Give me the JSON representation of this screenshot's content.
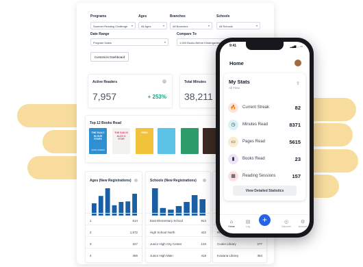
{
  "filters": {
    "programs": {
      "label": "Programs",
      "value": "Summer Reading Challenge"
    },
    "ages": {
      "label": "Ages",
      "value": "All Ages"
    },
    "branches": {
      "label": "Branches",
      "value": "All Branches"
    },
    "schools": {
      "label": "Schools",
      "value": "All Schools"
    },
    "date_range": {
      "label": "Date Range",
      "value": "Program Dates"
    },
    "compare_to": {
      "label": "Compare To",
      "value": "1,000 Books Before Kindergarten"
    },
    "customize_label": "Customize Dashboard"
  },
  "stats": {
    "active_readers": {
      "title": "Active Readers",
      "value": "7,957",
      "change": "+ 253%"
    },
    "total_minutes": {
      "title": "Total Minutes",
      "value": "38,211"
    }
  },
  "books": {
    "title": "Top 12 Books Read",
    "items": [
      {
        "name": "the-fault-in-our-stars",
        "cover_text": "THE FAULT IN OUR STARS",
        "author": "JOHN GREEN",
        "bg": "#2e8fd1",
        "fg": "#ffffff"
      },
      {
        "name": "the-sun-is-also-a-star",
        "cover_text": "THE SUN IS ALSO A STAR",
        "author": "",
        "bg": "#f2f2ee",
        "fg": "#e7357a"
      },
      {
        "name": "fred",
        "cover_text": "FRED",
        "author": "",
        "bg": "#f1c33b",
        "fg": "#ffffff"
      },
      {
        "name": "wonder",
        "cover_text": "",
        "author": "",
        "bg": "#5cc2e6",
        "fg": "#ffffff"
      },
      {
        "name": "green-book",
        "cover_text": "",
        "author": "",
        "bg": "#2d9c6a",
        "fg": "#ffffff"
      },
      {
        "name": "dark-book",
        "cover_text": "",
        "author": "",
        "bg": "#3c2a22",
        "fg": "#ffffff"
      }
    ]
  },
  "ages_chart": {
    "title": "Ages (New Registrations)",
    "chart_data": {
      "type": "bar",
      "values": [
        0.45,
        0.72,
        1.0,
        0.38,
        0.5,
        0.52,
        0.8
      ],
      "ylim": [
        0,
        1
      ]
    },
    "rows": [
      {
        "label": "1",
        "value": "614"
      },
      {
        "label": "2",
        "value": "1,572"
      },
      {
        "label": "3",
        "value": "327"
      },
      {
        "label": "4",
        "value": "456"
      }
    ]
  },
  "schools_chart": {
    "title": "Schools (New Registrations)",
    "chart_data": {
      "type": "bar",
      "values": [
        1.0,
        0.28,
        0.22,
        0.35,
        0.5,
        0.75,
        0.6
      ],
      "ylim": [
        0,
        1
      ]
    },
    "rows": [
      {
        "label": "East Elementary School",
        "value": "814"
      },
      {
        "label": "High School North",
        "value": "422"
      },
      {
        "label": "Junior High City Center",
        "value": "133"
      },
      {
        "label": "Junior High Main",
        "value": "418"
      }
    ]
  },
  "third_chart": {
    "rows": [
      {
        "label": "Cesi",
        "value": ""
      },
      {
        "label": "Rive",
        "value": ""
      },
      {
        "label": "Cooks Library",
        "value": "277"
      },
      {
        "label": "Kowana Library",
        "value": "364"
      }
    ]
  },
  "phone": {
    "time": "9:41",
    "header": "Home",
    "card_title": "My Stats",
    "card_subtitle": "All Time",
    "stats": [
      {
        "label": "Current Streak",
        "value": "82",
        "icon": "flame-icon",
        "glyph": "🔥",
        "bg": "#fde4df"
      },
      {
        "label": "Minutes Read",
        "value": "8371",
        "icon": "clock-icon",
        "glyph": "◷",
        "bg": "#d9f0f4"
      },
      {
        "label": "Pages Read",
        "value": "5615",
        "icon": "book-icon",
        "glyph": "▭",
        "bg": "#fdebcb"
      },
      {
        "label": "Books Read",
        "value": "23",
        "icon": "book-stack-icon",
        "glyph": "▮",
        "bg": "#ede3f6"
      },
      {
        "label": "Reading Sessions",
        "value": "157",
        "icon": "calendar-icon",
        "glyph": "▦",
        "bg": "#fde1e1"
      }
    ],
    "detail_button": "View Detailed Statistics",
    "tabs": [
      {
        "label": "Home",
        "glyph": "⌂"
      },
      {
        "label": "Log",
        "glyph": "▤"
      },
      {
        "label": "Discover",
        "glyph": "◎"
      },
      {
        "label": "Account",
        "glyph": "⚙"
      }
    ]
  }
}
